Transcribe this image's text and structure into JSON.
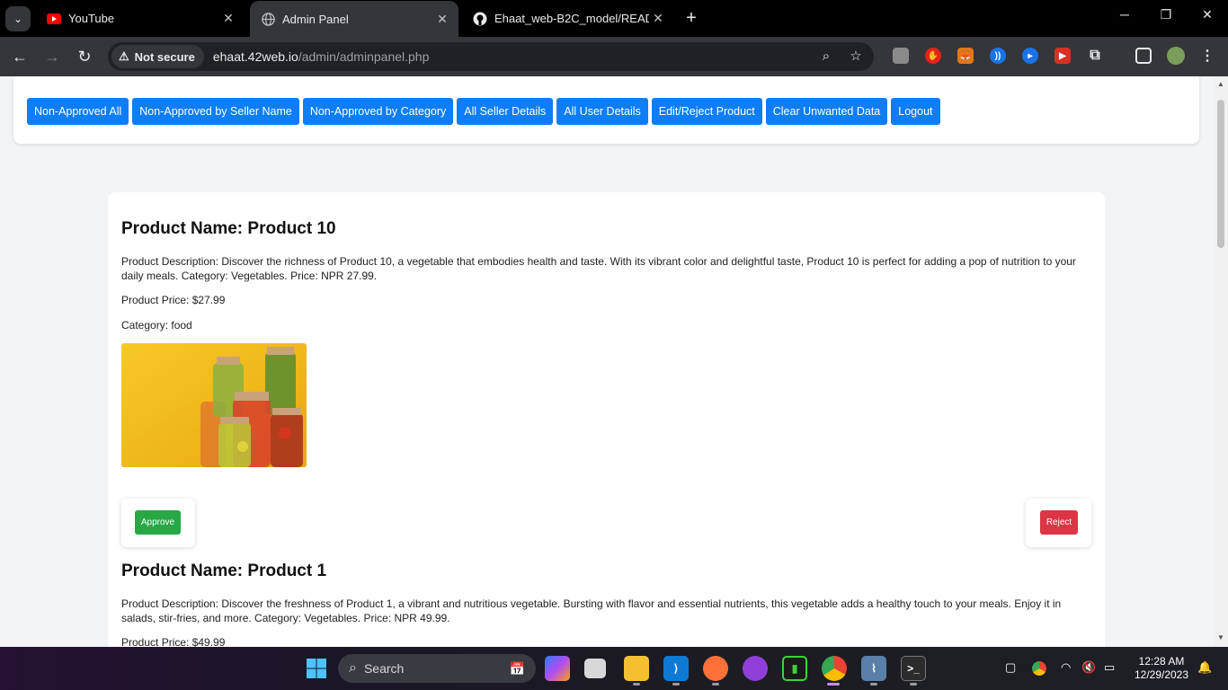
{
  "browser": {
    "tabs": [
      {
        "title": "YouTube",
        "icon": "youtube-icon"
      },
      {
        "title": "Admin Panel",
        "icon": "globe-icon"
      },
      {
        "title": "Ehaat_web-B2C_model/READM",
        "icon": "github-icon"
      }
    ],
    "security_label": "Not secure",
    "url_host": "ehaat.42web.io",
    "url_path": "/admin/adminpanel.php"
  },
  "admin_nav": {
    "buttons": [
      "Non-Approved All",
      "Non-Approved by Seller Name",
      "Non-Approved by Category",
      "All Seller Details",
      "All User Details",
      "Edit/Reject Product",
      "Clear Unwanted Data",
      "Logout"
    ],
    "color": "#0d7ef7"
  },
  "products": [
    {
      "name": "Product Name: Product 10",
      "description": "Product Description: Discover the richness of Product 10, a vegetable that embodies health and taste. With its vibrant color and delightful taste, Product 10 is perfect for adding a pop of nutrition to your daily meals. Category: Vegetables. Price: NPR 27.99.",
      "price": "Product Price: $27.99",
      "category": "Category: food",
      "approve_label": "Approve",
      "reject_label": "Reject"
    },
    {
      "name": "Product Name: Product 1",
      "description": "Product Description: Discover the freshness of Product 1, a vibrant and nutritious vegetable. Bursting with flavor and essential nutrients, this vegetable adds a healthy touch to your meals. Enjoy it in salads, stir-fries, and more. Category: Vegetables. Price: NPR 49.99.",
      "price": "Product Price: $49.99"
    }
  ],
  "colors": {
    "approve": "#28a745",
    "reject": "#dc3545"
  },
  "taskbar": {
    "search_label": "Search",
    "time": "12:28 AM",
    "date": "12/29/2023"
  }
}
